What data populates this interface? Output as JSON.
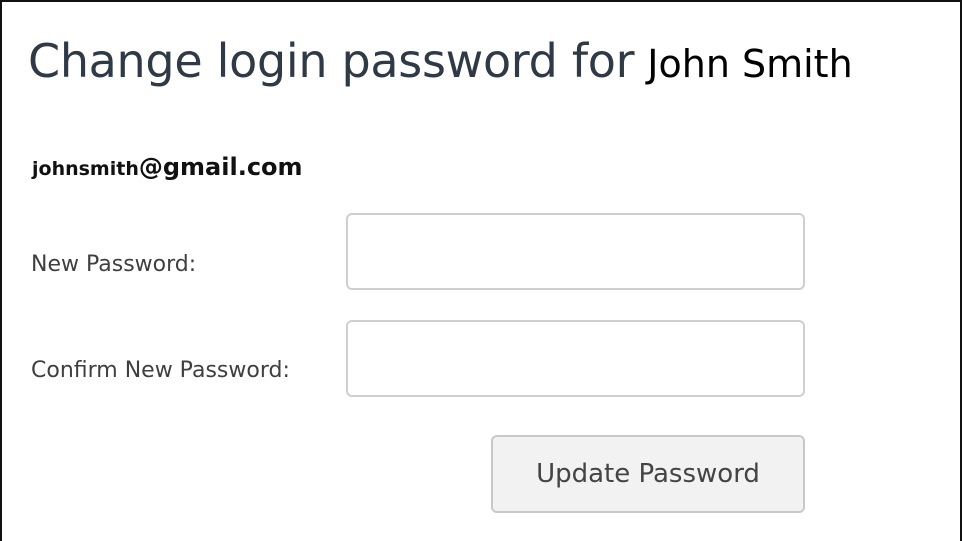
{
  "form": {
    "title_prefix": "Change login password for",
    "user_name": "John Smith",
    "email_local": "johnsmith",
    "email_domain": "@gmail.com",
    "new_password": {
      "label": "New Password:",
      "value": ""
    },
    "confirm_password": {
      "label": "Confirm New Password:",
      "value": ""
    },
    "submit_label": "Update Password"
  }
}
